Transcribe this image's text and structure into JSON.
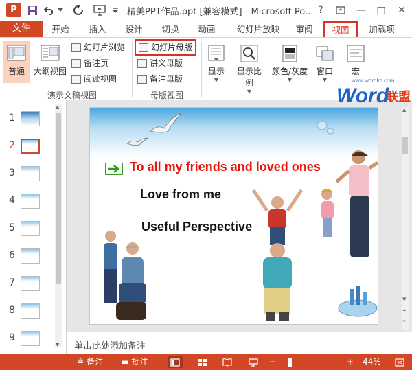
{
  "window": {
    "title": "精美PPT作品.ppt [兼容模式] - Microsoft Po...",
    "app_icon_letter": "P",
    "help": "?",
    "restore": "▣",
    "minimize": "—",
    "maximize": "□",
    "close": "✕"
  },
  "ribbon_tabs": {
    "file": "文件",
    "home": "开始",
    "insert": "插入",
    "design": "设计",
    "transitions": "切换",
    "animations": "动画",
    "slideshow": "幻灯片放映",
    "review": "审阅",
    "view": "视图",
    "addins": "加载项"
  },
  "ribbon": {
    "presentation_views": {
      "normal": "普通",
      "outline": "大纲视图",
      "slide_sorter": "幻灯片浏览",
      "notes_page": "备注页",
      "reading_view": "阅读视图",
      "group_label": "演示文稿视图"
    },
    "master_views": {
      "slide_master": "幻灯片母版",
      "handout_master": "讲义母版",
      "notes_master": "备注母版",
      "group_label": "母版视图"
    },
    "show": "显示",
    "zoom": "显示比例",
    "color_gray": "颜色/灰度",
    "window": "窗口",
    "macros": "宏"
  },
  "watermark": {
    "url": "www.wordlm.com",
    "brand_word": "Word",
    "brand_cn": "联盟"
  },
  "thumbnails": [
    {
      "num": "1"
    },
    {
      "num": "2"
    },
    {
      "num": "3"
    },
    {
      "num": "4"
    },
    {
      "num": "5"
    },
    {
      "num": "6"
    },
    {
      "num": "7"
    },
    {
      "num": "8"
    },
    {
      "num": "9"
    }
  ],
  "slide": {
    "heading": "To all my friends and loved ones",
    "line1": "Love from me",
    "line2": "Useful Perspective",
    "page_number": "2"
  },
  "notes_placeholder": "单击此处添加备注",
  "statusbar": {
    "notes": "备注",
    "comments": "批注",
    "zoom_level": "44%",
    "zoom_minus": "−",
    "zoom_plus": "+",
    "zoom_fraction": 0.44
  },
  "colors": {
    "accent": "#d24726",
    "highlight": "#fad2bf",
    "heading_red": "#e8140c",
    "outline_red": "#d9302c"
  }
}
